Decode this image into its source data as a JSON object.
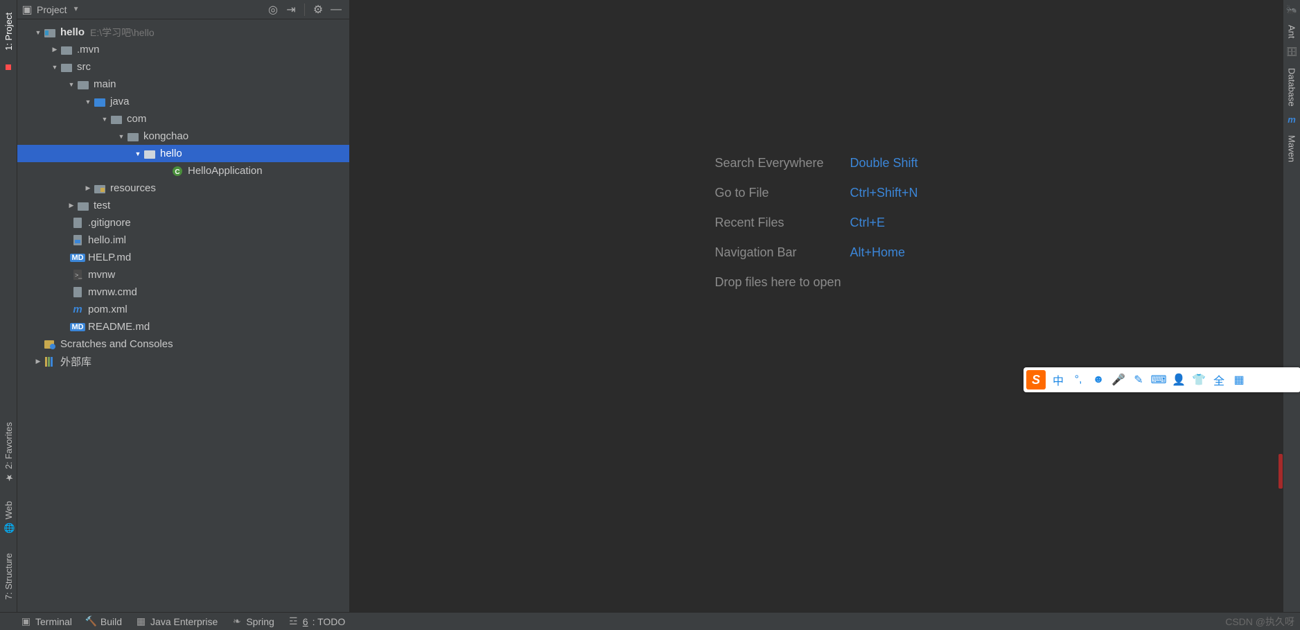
{
  "leftStrip": {
    "project": "1: Project",
    "favorites": "2: Favorites",
    "web": "Web",
    "structure": "7: Structure"
  },
  "rightStrip": {
    "ant": "Ant",
    "database": "Database",
    "maven": "Maven"
  },
  "projectPanel": {
    "title": "Project"
  },
  "tree": {
    "rootName": "hello",
    "rootPath": "E:\\学习吧\\hello",
    "mvn": ".mvn",
    "src": "src",
    "main": "main",
    "java": "java",
    "com": "com",
    "kongchao": "kongchao",
    "helloPkg": "hello",
    "helloApp": "HelloApplication",
    "resources": "resources",
    "test": "test",
    "gitignore": ".gitignore",
    "iml": "hello.iml",
    "helpmd": "HELP.md",
    "mvnw": "mvnw",
    "mvnwcmd": "mvnw.cmd",
    "pom": "pom.xml",
    "readme": "README.md",
    "scratches": "Scratches and Consoles",
    "external": "外部库"
  },
  "hints": {
    "search": {
      "label": "Search Everywhere",
      "key": "Double Shift"
    },
    "goto": {
      "label": "Go to File",
      "key": "Ctrl+Shift+N"
    },
    "recent": {
      "label": "Recent Files",
      "key": "Ctrl+E"
    },
    "nav": {
      "label": "Navigation Bar",
      "key": "Alt+Home"
    },
    "drop": "Drop files here to open"
  },
  "bottomBar": {
    "terminal": "Terminal",
    "build": "Build",
    "javaee": "Java Enterprise",
    "spring": "Spring",
    "todoPrefix": "6",
    "todo": ": TODO",
    "watermark": "CSDN @执久呀"
  },
  "ime": {
    "logo": "S",
    "zhong": "中",
    "quan": "全"
  }
}
